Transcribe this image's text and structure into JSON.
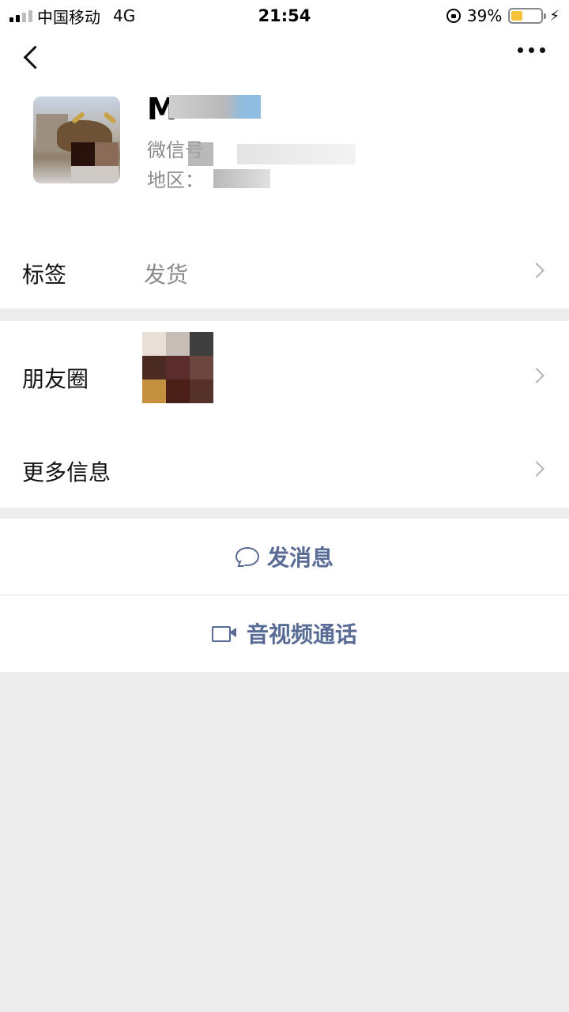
{
  "status_bar": {
    "carrier": "中国移动",
    "network": "4G",
    "time": "21:54",
    "battery_percent": "39%",
    "battery_level": 0.39
  },
  "profile": {
    "name": "M",
    "wechat_id_label": "微信号",
    "region_label": "地区："
  },
  "tag_row": {
    "label": "标签",
    "value": "发货"
  },
  "moments_row": {
    "label": "朋友圈"
  },
  "more_info_row": {
    "label": "更多信息"
  },
  "actions": {
    "send_message": "发消息",
    "av_call": "音视频通话"
  },
  "colors": {
    "link": "#576b95",
    "battery": "#f5c33b",
    "page_bg": "#ededed"
  }
}
